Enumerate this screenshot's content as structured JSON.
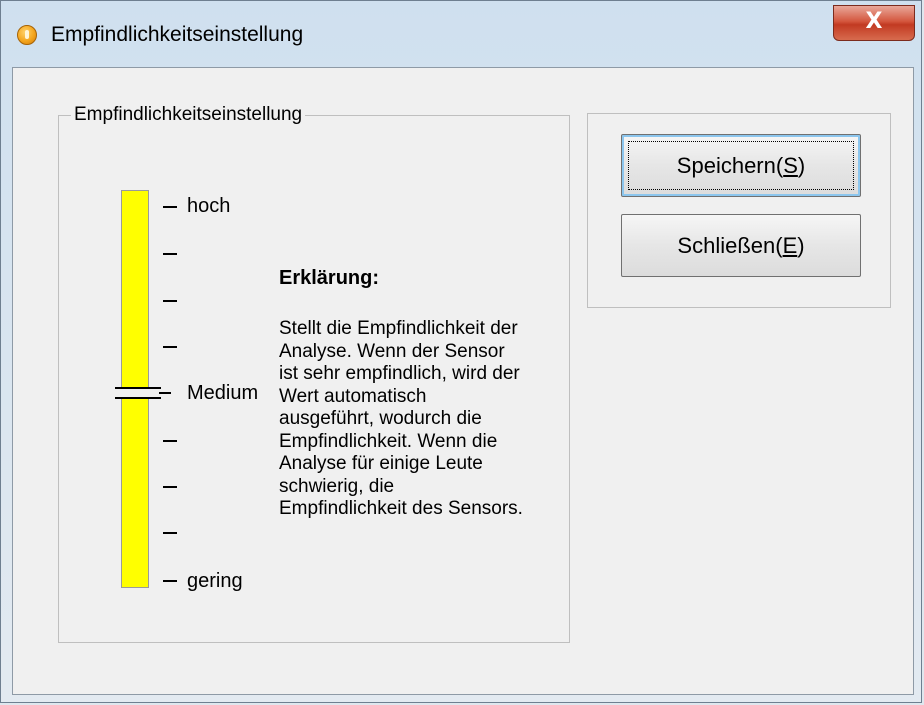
{
  "window": {
    "title": "Empfindlichkeitseinstellung",
    "close_glyph": "X"
  },
  "sensitivity": {
    "group_label": "Empfindlichkeitseinstellung",
    "slider_level": "Medium",
    "track_color": "#ffff00",
    "labels": {
      "high": "hoch",
      "medium": "Medium",
      "low": "gering"
    }
  },
  "explanation": {
    "title": "Erklärung:",
    "lines": [
      "Stellt die Empfindlichkeit der",
      "Analyse. Wenn der Sensor",
      "ist sehr empfindlich, wird der",
      "Wert automatisch",
      "ausgeführt, wodurch die",
      "Empfindlichkeit. Wenn die",
      "Analyse für einige Leute",
      "schwierig, die",
      "Empfindlichkeit des Sensors."
    ]
  },
  "buttons": {
    "save_prefix": "Speichern(",
    "save_key": "S",
    "save_suffix": ")",
    "close_prefix": "Schließen(",
    "close_key": "E",
    "close_suffix": ")"
  }
}
